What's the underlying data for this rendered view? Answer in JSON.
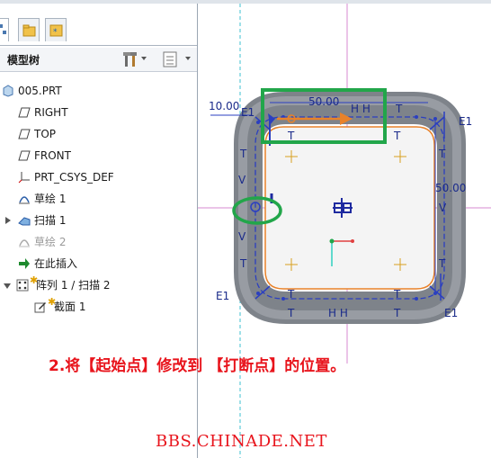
{
  "model_tree": {
    "header_title": "模型树",
    "items": [
      {
        "label": "005.PRT"
      },
      {
        "label": "RIGHT"
      },
      {
        "label": "TOP"
      },
      {
        "label": "FRONT"
      },
      {
        "label": "PRT_CSYS_DEF"
      },
      {
        "label": "草绘 1"
      },
      {
        "label": "扫描 1"
      },
      {
        "label": "草绘 2"
      },
      {
        "label": "在此插入"
      },
      {
        "label": "阵列 1 / 扫描 2"
      },
      {
        "label": "截面 1"
      }
    ]
  },
  "sketch": {
    "dim_top": "50.00",
    "dim_left": "10.00",
    "dim_right": "50.00",
    "label_e1": "E1",
    "label_t": "T",
    "label_v": "V",
    "label_hh": "H H"
  },
  "annotation": "2.将【起始点】修改到 【打断点】的位置。",
  "watermark": "BBS.CHINADE.NET",
  "colors": {
    "accent_red": "#e8141c",
    "highlight_green": "#22a64a",
    "sketch_orange": "#e8822a",
    "dim_blue": "#1a2a8a"
  }
}
